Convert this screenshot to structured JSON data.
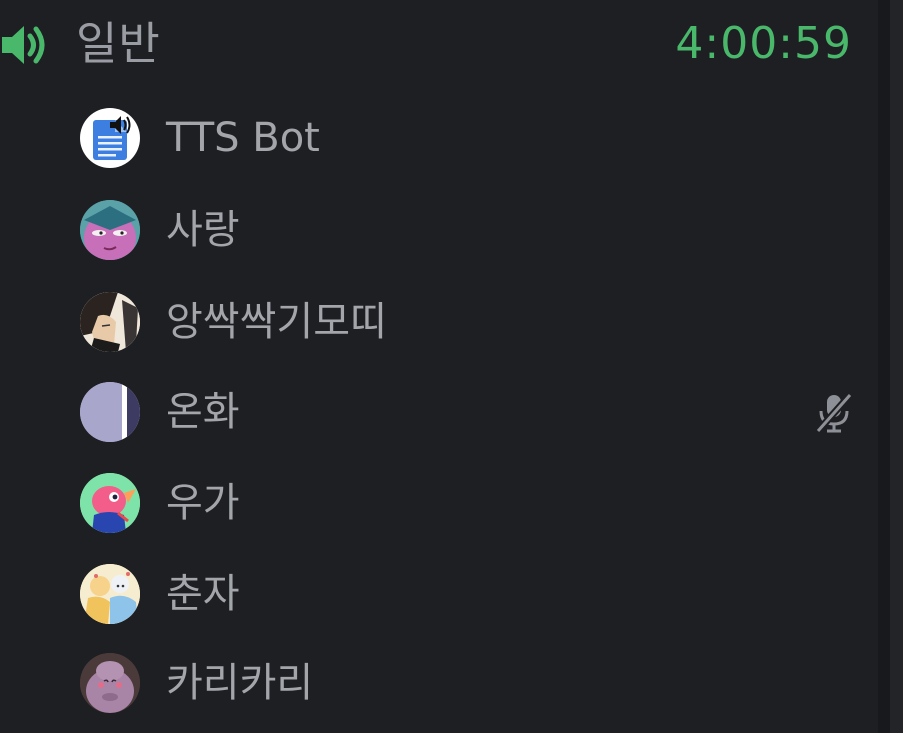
{
  "channel": {
    "icon": "speaker-icon",
    "name": "일반",
    "elapsed": "4:00:59",
    "elapsed_color": "#4ab86b"
  },
  "members": [
    {
      "name": "TTS Bot",
      "avatar": "document-speaker-avatar",
      "muted": false
    },
    {
      "name": "사랑",
      "avatar": "pink-character-avatar",
      "muted": false
    },
    {
      "name": "앙싹싹기모띠",
      "avatar": "dark-hair-character-avatar",
      "muted": false
    },
    {
      "name": "온화",
      "avatar": "lavender-avatar",
      "muted": true
    },
    {
      "name": "우가",
      "avatar": "pink-bird-avatar",
      "muted": false
    },
    {
      "name": "춘자",
      "avatar": "pastel-illustration-avatar",
      "muted": false
    },
    {
      "name": "카리카리",
      "avatar": "purple-creature-avatar",
      "muted": false
    }
  ],
  "colors": {
    "background": "#1e1f23",
    "text": "#a3a5ab",
    "muted_icon": "#8e9097"
  }
}
